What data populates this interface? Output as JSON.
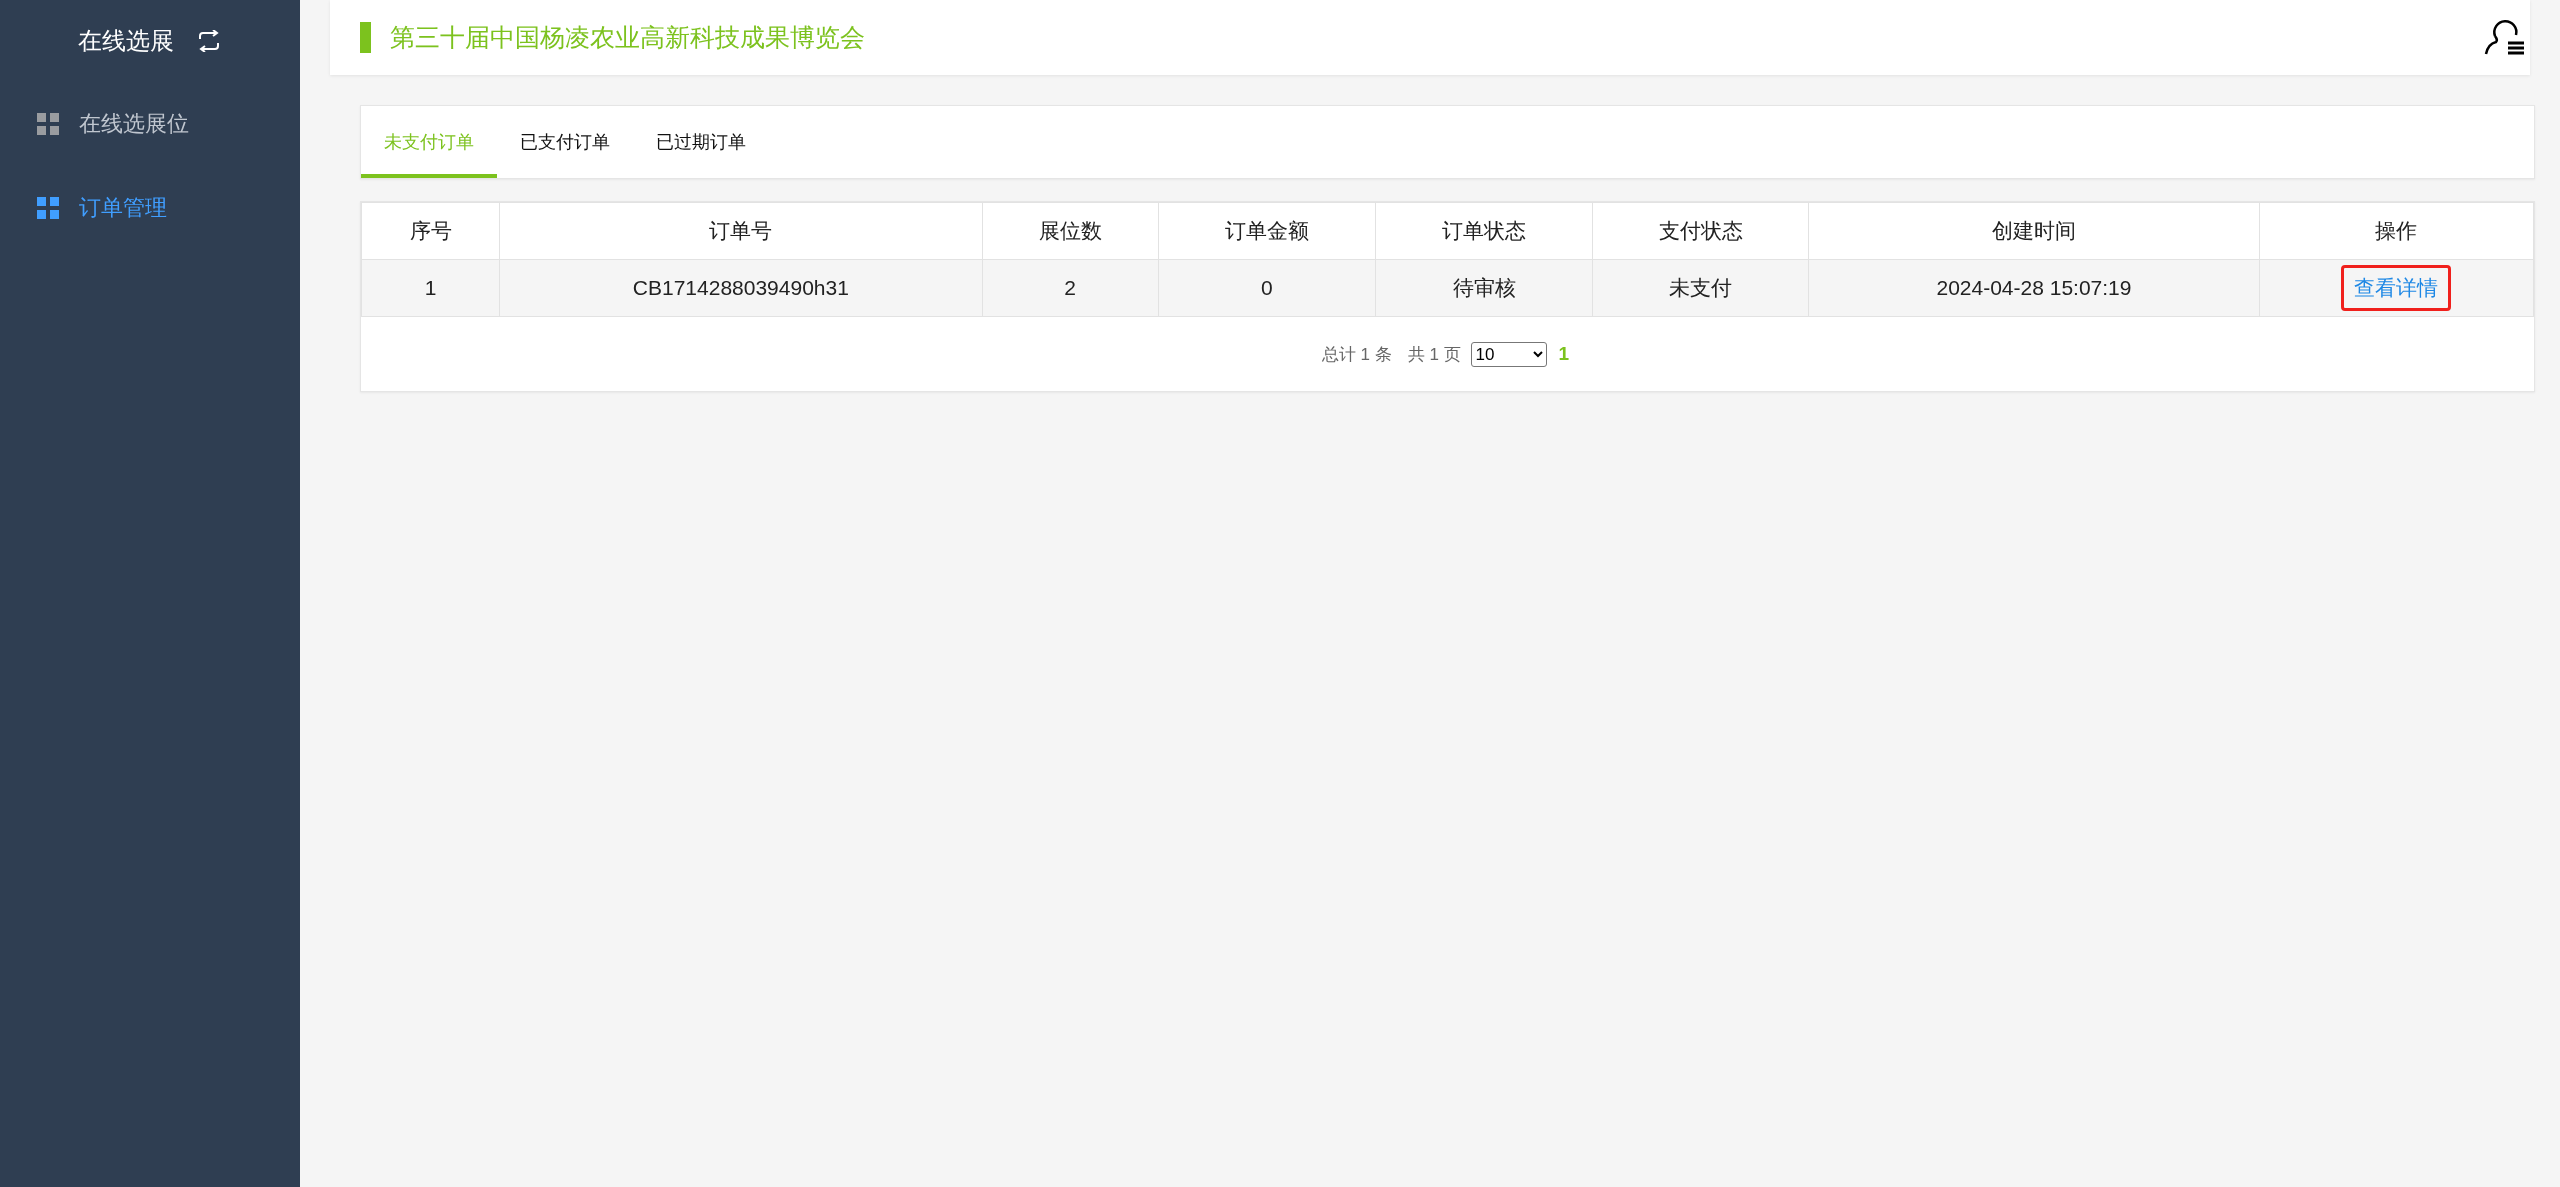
{
  "sidebar": {
    "title": "在线选展",
    "items": [
      {
        "label": "在线选展位",
        "selected": false
      },
      {
        "label": "订单管理",
        "selected": true
      }
    ]
  },
  "header": {
    "title": "第三十届中国杨凌农业高新科技成果博览会"
  },
  "tabs": [
    {
      "label": "未支付订单",
      "selected": true
    },
    {
      "label": "已支付订单",
      "selected": false
    },
    {
      "label": "已过期订单",
      "selected": false
    }
  ],
  "table": {
    "columns": [
      "序号",
      "订单号",
      "展位数",
      "订单金额",
      "订单状态",
      "支付状态",
      "创建时间",
      "操作"
    ],
    "rows": [
      {
        "cells": [
          "1",
          "CB1714288039490h31",
          "2",
          "0",
          "待审核",
          "未支付",
          "2024-04-28 15:07:19"
        ],
        "action": "查看详情",
        "highlighted": true
      }
    ]
  },
  "pagination": {
    "total": "总计 1 条",
    "pages_count": "共 1 页",
    "page_size": "10",
    "pages": [
      {
        "label": "1",
        "selected": true
      }
    ]
  }
}
